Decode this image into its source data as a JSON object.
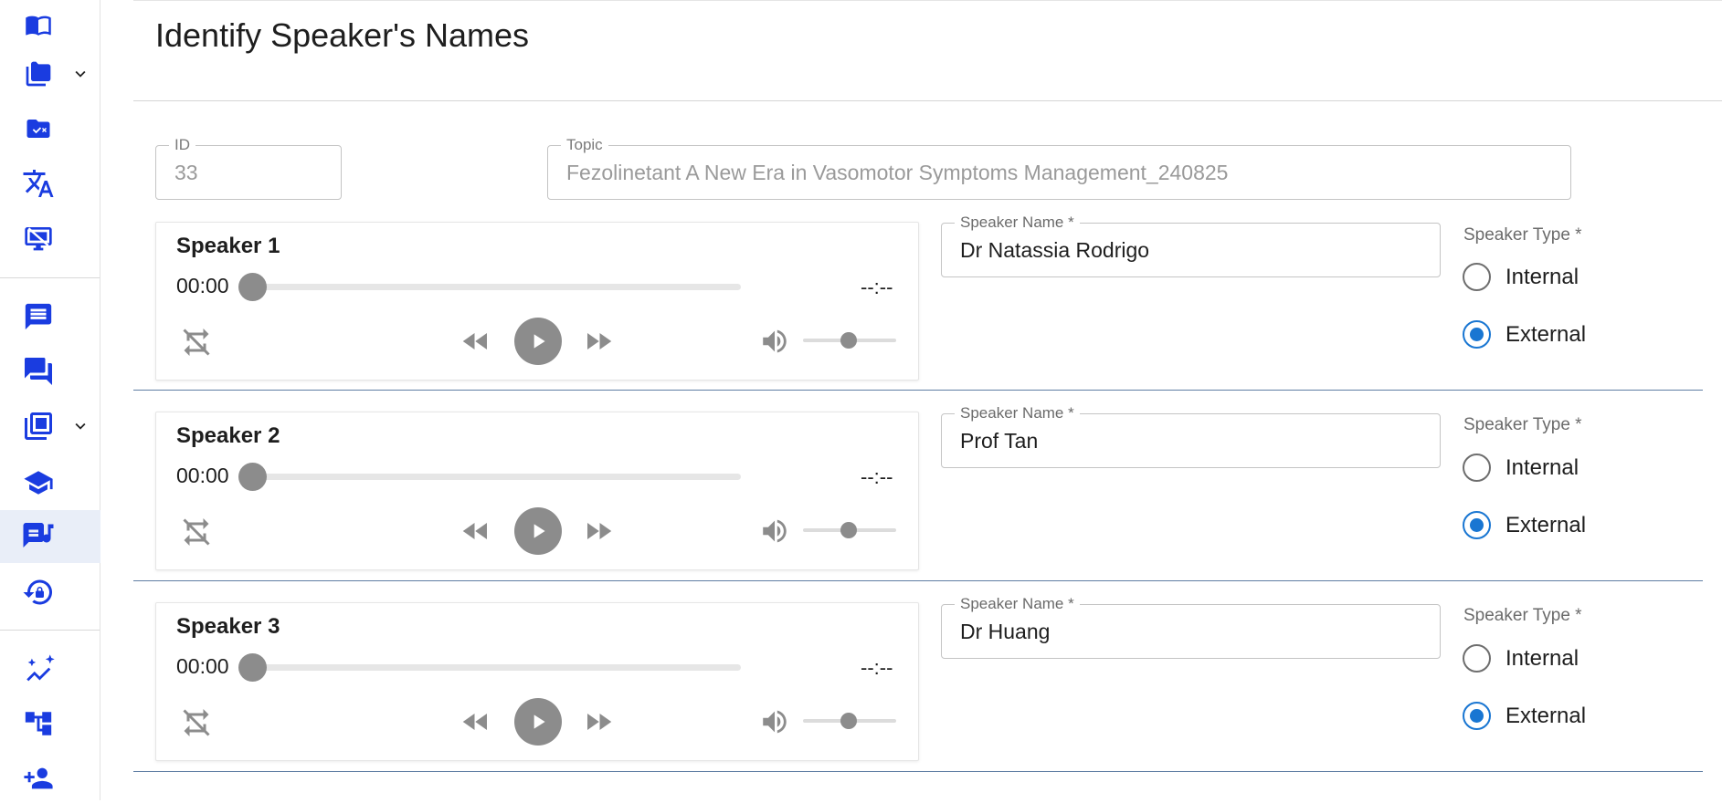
{
  "page": {
    "title": "Identify Speaker's Names"
  },
  "colors": {
    "accent": "#1a3ce0",
    "radio_selected": "#1976d2",
    "control_gray": "#8c8c8c"
  },
  "sidebar": {
    "items": [
      {
        "icon": "book-icon"
      },
      {
        "icon": "folder-icon",
        "has_dropdown": true
      },
      {
        "icon": "folder-check-icon"
      },
      {
        "icon": "translate-icon"
      },
      {
        "icon": "presentation-off-icon"
      },
      {
        "icon": "comment-icon"
      },
      {
        "icon": "forum-icon"
      },
      {
        "icon": "library-icon",
        "has_dropdown": true
      },
      {
        "icon": "school-icon"
      },
      {
        "icon": "speaker-notes-icon",
        "active": true
      },
      {
        "icon": "lock-reset-icon"
      },
      {
        "icon": "analytics-icon"
      },
      {
        "icon": "hierarchy-icon"
      },
      {
        "icon": "add-user-icon"
      }
    ]
  },
  "meta_fields": {
    "id": {
      "label": "ID",
      "value": "33"
    },
    "topic": {
      "label": "Topic",
      "value": "Fezolinetant A New Era in Vasomotor Symptoms Management_240825"
    }
  },
  "speakers": [
    {
      "title": "Speaker 1",
      "current_time": "00:00",
      "duration": "--:--",
      "progress": 0,
      "volume": 0.5,
      "name_label": "Speaker Name *",
      "name_value": "Dr Natassia Rodrigo",
      "type_label": "Speaker Type *",
      "options": [
        "Internal",
        "External"
      ],
      "selected": "External"
    },
    {
      "title": "Speaker 2",
      "current_time": "00:00",
      "duration": "--:--",
      "progress": 0,
      "volume": 0.5,
      "name_label": "Speaker Name *",
      "name_value": "Prof Tan",
      "type_label": "Speaker Type *",
      "options": [
        "Internal",
        "External"
      ],
      "selected": "External"
    },
    {
      "title": "Speaker 3",
      "current_time": "00:00",
      "duration": "--:--",
      "progress": 0,
      "volume": 0.5,
      "name_label": "Speaker Name *",
      "name_value": "Dr Huang",
      "type_label": "Speaker Type *",
      "options": [
        "Internal",
        "External"
      ],
      "selected": "External"
    }
  ]
}
